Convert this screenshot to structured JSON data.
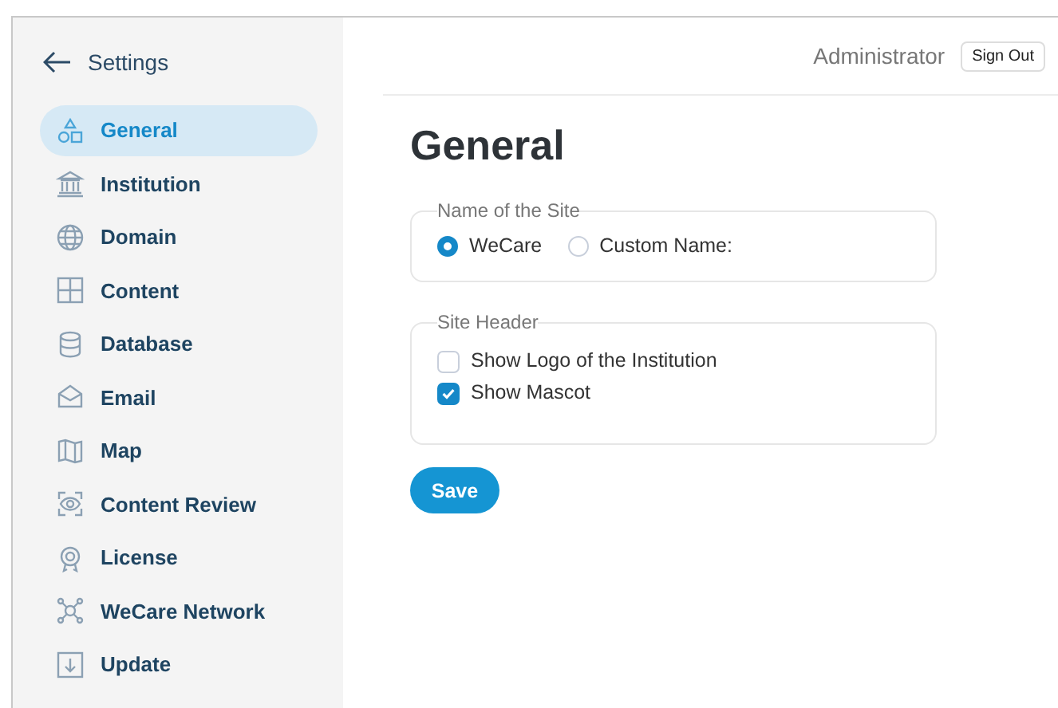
{
  "sidebar": {
    "back_label": "Settings",
    "items": [
      {
        "label": "General",
        "selected": true
      },
      {
        "label": "Institution",
        "selected": false
      },
      {
        "label": "Domain",
        "selected": false
      },
      {
        "label": "Content",
        "selected": false
      },
      {
        "label": "Database",
        "selected": false
      },
      {
        "label": "Email",
        "selected": false
      },
      {
        "label": "Map",
        "selected": false
      },
      {
        "label": "Content Review",
        "selected": false
      },
      {
        "label": "License",
        "selected": false
      },
      {
        "label": "WeCare Network",
        "selected": false
      },
      {
        "label": "Update",
        "selected": false
      }
    ]
  },
  "header": {
    "user": "Administrator",
    "sign_out": "Sign Out"
  },
  "page_title": "General",
  "site_name": {
    "legend": "Name of the Site",
    "options": [
      {
        "label": "WeCare",
        "selected": true
      },
      {
        "label": "Custom Name:",
        "selected": false
      }
    ]
  },
  "site_header": {
    "legend": "Site Header",
    "options": [
      {
        "label": "Show Logo of the Institution",
        "checked": false
      },
      {
        "label": "Show Mascot",
        "checked": true
      }
    ]
  },
  "save_button": "Save"
}
